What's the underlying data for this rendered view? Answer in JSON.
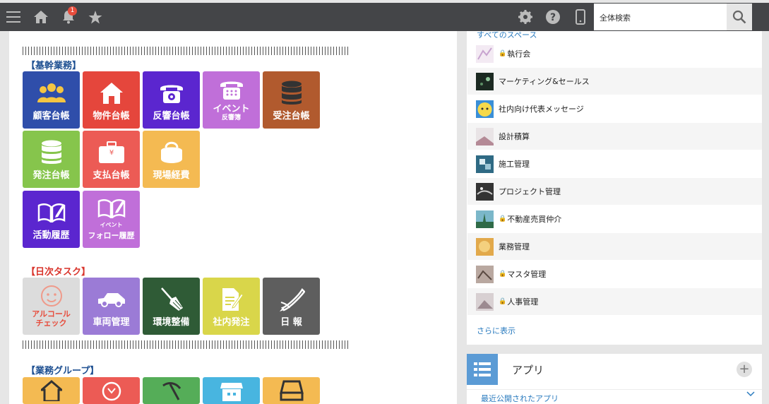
{
  "topbar": {
    "notification_count": "1",
    "search_placeholder": "全体検索",
    "icons": [
      "menu-icon",
      "home-icon",
      "bell-icon",
      "star-icon",
      "gear-icon",
      "help-icon",
      "mobile-icon",
      "search-icon"
    ]
  },
  "portal": {
    "sections": [
      {
        "title": "【基幹業務】",
        "color": "#1d4f91",
        "tiles": [
          {
            "label": "顧客台帳",
            "icon": "people-icon",
            "color": "#2f4eaa"
          },
          {
            "label": "物件台帳",
            "icon": "house-icon",
            "color": "#e5463c"
          },
          {
            "label": "反響台帳",
            "icon": "phone-icon",
            "color": "#5b26cf"
          },
          {
            "label": "イベント",
            "sub": "反響簿",
            "icon": "phone-icon",
            "color": "#c06fd9"
          },
          {
            "label": "受注台帳",
            "icon": "database-icon",
            "color": "#b15a2e"
          },
          {
            "label": "発注台帳",
            "icon": "database-icon",
            "color": "#86c54c"
          },
          {
            "label": "支払台帳",
            "icon": "suitcase-icon",
            "color": "#ec5b55"
          },
          {
            "label": "現場経費",
            "icon": "purse-icon",
            "color": "#f4ba52"
          },
          {
            "label": "活動履歴",
            "icon": "book-icon",
            "color": "#5b26cf"
          },
          {
            "label": "フォロー履歴",
            "sub_top": "イベント",
            "icon": "book-icon",
            "color": "#c06fd9"
          }
        ]
      },
      {
        "title": "【日次タスク】",
        "color": "#d9342b",
        "tiles": [
          {
            "label": "アルコール",
            "sub": "チェック",
            "icon": "face-icon",
            "color": "#dcdcdc",
            "text_color": "#e74c3c"
          },
          {
            "label": "車両管理",
            "icon": "car-icon",
            "color": "#9b7bd6"
          },
          {
            "label": "環境整備",
            "icon": "broom-icon",
            "color": "#2f5b36"
          },
          {
            "label": "社内発注",
            "icon": "document-edit-icon",
            "color": "#d9d64a"
          },
          {
            "label": "日 報",
            "icon": "pen-icon",
            "color": "#5e5e5e"
          }
        ]
      },
      {
        "title": "【業務グループ】",
        "color": "#1d4f91",
        "tiles": [
          {
            "icon": "house-icon",
            "color": "#f4ba52"
          },
          {
            "icon": "brain-icon",
            "color": "#ec5b55"
          },
          {
            "icon": "pickaxe-icon",
            "color": "#55ad58"
          },
          {
            "icon": "shop-icon",
            "color": "#48b5e0"
          },
          {
            "icon": "tray-icon",
            "color": "#f4ba52"
          }
        ]
      }
    ]
  },
  "spaces": {
    "header": "すべてのスペース",
    "items": [
      {
        "name": "執行会",
        "locked": true
      },
      {
        "name": "マーケティング&セールス",
        "locked": false
      },
      {
        "name": "社内向け代表メッセージ",
        "locked": false
      },
      {
        "name": "設計積算",
        "locked": false
      },
      {
        "name": "施工管理",
        "locked": false
      },
      {
        "name": "プロジェクト管理",
        "locked": false
      },
      {
        "name": "不動産売買仲介",
        "locked": true
      },
      {
        "name": "業務管理",
        "locked": false
      },
      {
        "name": "マスタ管理",
        "locked": true
      },
      {
        "name": "人事管理",
        "locked": true
      }
    ],
    "more_label": "さらに表示"
  },
  "apps": {
    "title": "アプリ",
    "add_label": "+",
    "recent_label": "最近公開されたアプリ"
  }
}
